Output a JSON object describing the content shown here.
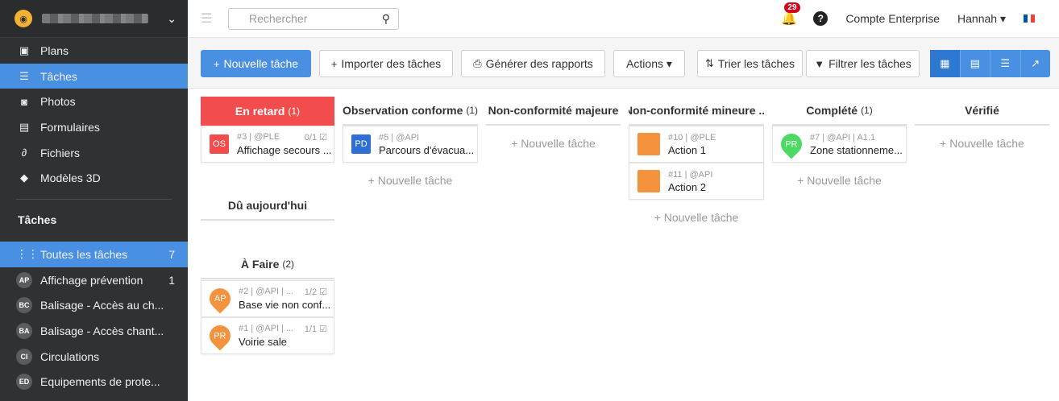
{
  "sidebar": {
    "nav": [
      {
        "label": "Plans",
        "icon": "plans-icon"
      },
      {
        "label": "Tâches",
        "icon": "list-icon"
      },
      {
        "label": "Photos",
        "icon": "camera-icon"
      },
      {
        "label": "Formulaires",
        "icon": "clipboard-icon"
      },
      {
        "label": "Fichiers",
        "icon": "paperclip-icon"
      },
      {
        "label": "Modèles 3D",
        "icon": "cube-icon"
      }
    ],
    "section_title": "Tâches",
    "categories": [
      {
        "badge": "",
        "label": "Toutes les tâches",
        "count": "7"
      },
      {
        "badge": "AP",
        "label": "Affichage prévention",
        "count": "1"
      },
      {
        "badge": "BC",
        "label": "Balisage - Accès au ch...",
        "count": ""
      },
      {
        "badge": "BA",
        "label": "Balisage - Accès chant...",
        "count": ""
      },
      {
        "badge": "CI",
        "label": "Circulations",
        "count": ""
      },
      {
        "badge": "ED",
        "label": "Equipements de prote...",
        "count": ""
      }
    ]
  },
  "topbar": {
    "search_placeholder": "Rechercher",
    "notifications": "29",
    "help": "?",
    "account": "Compte Enterprise",
    "user": "Hannah ▾"
  },
  "toolbar": {
    "new_task": "Nouvelle tâche",
    "import": "Importer des tâches",
    "report": "Générer des rapports",
    "actions": "Actions ▾",
    "sort": "Trier les tâches",
    "filter": "Filtrer les tâches"
  },
  "board": {
    "add_label": "+ Nouvelle tâche",
    "columns": [
      {
        "title": "En retard",
        "count": "(1)"
      },
      {
        "title": "Observation conforme",
        "count": "(1)"
      },
      {
        "title": "Non-conformité majeure",
        "count": ""
      },
      {
        "title": "Non-conformité mineure ...",
        "count": ""
      },
      {
        "title": "Complété",
        "count": "(1)"
      },
      {
        "title": "Vérifié",
        "count": ""
      },
      {
        "title": "Dû aujourd'hui",
        "count": ""
      },
      {
        "title": "À Faire",
        "count": "(2)"
      }
    ],
    "cards": [
      {
        "badge": "OS",
        "meta": "#3 | @PLE",
        "progress": "0/1",
        "title": "Affichage secours ..."
      },
      {
        "badge": "PD",
        "meta": "#5 | @API",
        "progress": "",
        "title": "Parcours d'évacua..."
      },
      {
        "badge": "",
        "meta": "#10 | @PLE",
        "progress": "",
        "title": "Action 1"
      },
      {
        "badge": "",
        "meta": "#11 | @API",
        "progress": "",
        "title": "Action 2"
      },
      {
        "badge": "PR",
        "meta": "#7 | @API | A1.1",
        "progress": "",
        "title": "Zone stationneme..."
      },
      {
        "badge": "AP",
        "meta": "#2 | @API | ...",
        "progress": "1/2",
        "title": "Base vie non conf..."
      },
      {
        "badge": "PR",
        "meta": "#1 | @API | ...",
        "progress": "1/1",
        "title": "Voirie sale"
      }
    ]
  }
}
